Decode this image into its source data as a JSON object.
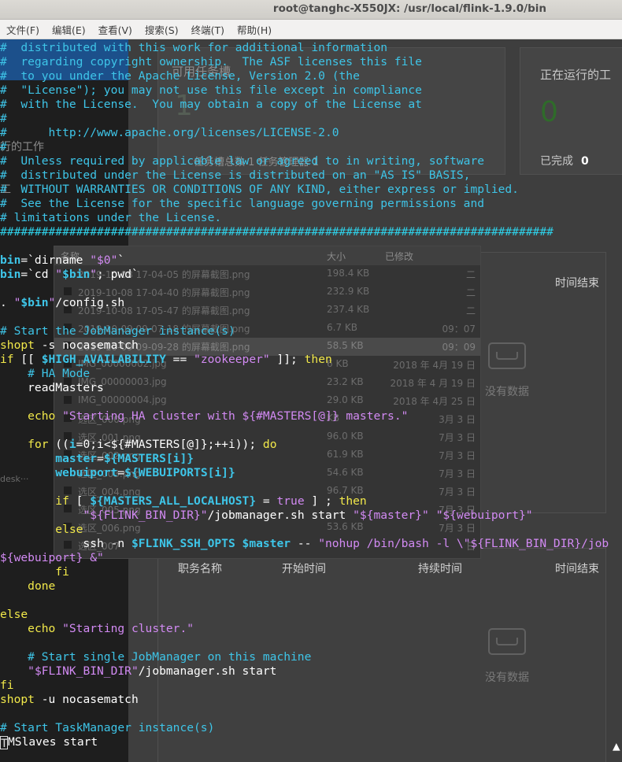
{
  "window": {
    "title": "root@tanghc-X550JX: /usr/local/flink-1.9.0/bin"
  },
  "menu": [
    "文件(F)",
    "编辑(E)",
    "查看(V)",
    "搜索(S)",
    "终端(T)",
    "帮助(H)"
  ],
  "background": {
    "slots_label": "可用任务槽",
    "slots_value": "1",
    "slots_footer": "任务槽总数 1   任务管理器 1",
    "running_jobs_label": "正在运行的工",
    "running_count": "0",
    "completed_label": "已完成",
    "completed_value": "0",
    "running_side_label": "行的工作",
    "work_side_label": "工",
    "end_time_label": "时间结束",
    "no_data": "没有数据",
    "desk_label": "desk···",
    "table_headers": [
      "职务名称",
      "开始时间",
      "持续时间",
      "时间结束"
    ],
    "file_headers": [
      "名称",
      "大小",
      "已修改"
    ],
    "files": [
      {
        "name": "2019-10-08 17-04-05 的屏幕截图.png",
        "size": "198.4 KB",
        "date": "二"
      },
      {
        "name": "2019-10-08 17-04-40 的屏幕截图.png",
        "size": "232.9 KB",
        "date": "二"
      },
      {
        "name": "2019-10-08 17-05-47 的屏幕截图.png",
        "size": "237.4 KB",
        "date": "二"
      },
      {
        "name": "2019-10-09 09-07-18 的屏幕截图.png",
        "size": "6.7 KB",
        "date": "09：07"
      },
      {
        "name": "2019-10-09 09-09-28 的屏幕截图.png",
        "size": "58.5 KB",
        "date": "09：09"
      },
      {
        "name": "IMG_00000002.jpg",
        "size": "6 KB",
        "date": "2018 年 4月 19 日"
      },
      {
        "name": "IMG_00000003.jpg",
        "size": "23.2 KB",
        "date": "2018 年 4 月 19 日"
      },
      {
        "name": "IMG_00000004.jpg",
        "size": "29.0 KB",
        "date": "2018 年 4月 25 日"
      },
      {
        "name": "选区_000.png",
        "size": "KB",
        "date": "3月 3 日"
      },
      {
        "name": "选区_001.png",
        "size": "96.0 KB",
        "date": "7月 3 日"
      },
      {
        "name": "选区_002.png",
        "size": "61.9 KB",
        "date": "7月 3 日"
      },
      {
        "name": "选区_003.png",
        "size": "54.6 KB",
        "date": "7月 3 日"
      },
      {
        "name": "选区_004.png",
        "size": "96.7 KB",
        "date": "7月 3 日"
      },
      {
        "name": "选区_005.png",
        "size": "",
        "date": "7月 3 日"
      },
      {
        "name": "选区_006.png",
        "size": "53.6 KB",
        "date": "7月 3 日"
      },
      {
        "name": "选区_007",
        "size": "",
        "date": "日"
      }
    ]
  },
  "terminal": {
    "lines": [
      [
        [
          "c",
          "#  distributed with this work for additional information"
        ]
      ],
      [
        [
          "c",
          "#  regarding copyright ownership.  The ASF licenses this file"
        ]
      ],
      [
        [
          "c",
          "#  to you under the Apache License, Version 2.0 (the"
        ]
      ],
      [
        [
          "c",
          "#  \"License\"); you may not use this file except in compliance"
        ]
      ],
      [
        [
          "c",
          "#  with the License.  You may obtain a copy of the License at"
        ]
      ],
      [
        [
          "c",
          "#"
        ]
      ],
      [
        [
          "c",
          "#      http://www.apache.org/licenses/LICENSE-2.0"
        ]
      ],
      [
        [
          "c",
          "#"
        ]
      ],
      [
        [
          "c",
          "#  Unless required by applicable law or agreed to in writing, software"
        ]
      ],
      [
        [
          "c",
          "#  distributed under the License is distributed on an \"AS IS\" BASIS,"
        ]
      ],
      [
        [
          "c",
          "#  WITHOUT WARRANTIES OR CONDITIONS OF ANY KIND, either express or implied."
        ]
      ],
      [
        [
          "c",
          "#  See the License for the specific language governing permissions and"
        ]
      ],
      [
        [
          "c",
          "# limitations under the License."
        ]
      ],
      [
        [
          "hash",
          "################################################################################"
        ]
      ],
      [
        [
          "t",
          ""
        ]
      ],
      [
        [
          "v",
          "bin"
        ],
        [
          "t",
          "=`dirname "
        ],
        [
          "s",
          "\"$0\""
        ],
        [
          "t",
          "`"
        ]
      ],
      [
        [
          "v",
          "bin"
        ],
        [
          "t",
          "=`cd "
        ],
        [
          "s",
          "\""
        ],
        [
          "v",
          "$bin"
        ],
        [
          "s",
          "\""
        ],
        [
          "t",
          "; pwd`"
        ]
      ],
      [
        [
          "t",
          ""
        ]
      ],
      [
        [
          "t",
          ". "
        ],
        [
          "s",
          "\""
        ],
        [
          "v",
          "$bin"
        ],
        [
          "s",
          "\""
        ],
        [
          "t",
          "/config.sh"
        ]
      ],
      [
        [
          "t",
          ""
        ]
      ],
      [
        [
          "c",
          "# Start the JobManager instance(s)"
        ]
      ],
      [
        [
          "k",
          "shopt"
        ],
        [
          "t",
          " -s nocasematch"
        ]
      ],
      [
        [
          "k",
          "if"
        ],
        [
          "t",
          " [[ "
        ],
        [
          "v",
          "$HIGH_AVAILABILITY"
        ],
        [
          "t",
          " == "
        ],
        [
          "s",
          "\"zookeeper\""
        ],
        [
          "t",
          " ]]; "
        ],
        [
          "k",
          "then"
        ]
      ],
      [
        [
          "c",
          "    # HA Mode"
        ]
      ],
      [
        [
          "t",
          "    readMasters"
        ]
      ],
      [
        [
          "t",
          ""
        ]
      ],
      [
        [
          "t",
          "    "
        ],
        [
          "k",
          "echo"
        ],
        [
          "s",
          " \"Starting HA cluster with ${#MASTERS[@]} masters.\""
        ]
      ],
      [
        [
          "t",
          ""
        ]
      ],
      [
        [
          "t",
          "    "
        ],
        [
          "k",
          "for"
        ],
        [
          "t",
          " (("
        ],
        [
          "v",
          "i"
        ],
        [
          "t",
          "=0;i<${#MASTERS[@]};++i)); "
        ],
        [
          "k",
          "do"
        ]
      ],
      [
        [
          "t",
          "        "
        ],
        [
          "v",
          "master"
        ],
        [
          "t",
          "="
        ],
        [
          "v",
          "${MASTERS[i]}"
        ]
      ],
      [
        [
          "t",
          "        "
        ],
        [
          "v",
          "webuiport"
        ],
        [
          "t",
          "="
        ],
        [
          "v",
          "${WEBUIPORTS[i]}"
        ]
      ],
      [
        [
          "t",
          ""
        ]
      ],
      [
        [
          "t",
          "        "
        ],
        [
          "k",
          "if"
        ],
        [
          "t",
          " [ "
        ],
        [
          "v",
          "${MASTERS_ALL_LOCALHOST}"
        ],
        [
          "t",
          " = "
        ],
        [
          "s",
          "true"
        ],
        [
          "t",
          " ] ; "
        ],
        [
          "k",
          "then"
        ]
      ],
      [
        [
          "t",
          "            "
        ],
        [
          "s",
          "\"${FLINK_BIN_DIR}\""
        ],
        [
          "t",
          "/jobmanager.sh start "
        ],
        [
          "s",
          "\"${master}\""
        ],
        [
          "t",
          " "
        ],
        [
          "s",
          "\"${webuiport}\""
        ]
      ],
      [
        [
          "t",
          "        "
        ],
        [
          "k",
          "else"
        ]
      ],
      [
        [
          "t",
          "            ssh -n "
        ],
        [
          "v",
          "$FLINK_SSH_OPTS"
        ],
        [
          "t",
          " "
        ],
        [
          "v",
          "$master"
        ],
        [
          "t",
          " -- "
        ],
        [
          "s",
          "\"nohup /bin/bash -l \\\"${FLINK_BIN_DIR}/job"
        ]
      ],
      [
        [
          "s",
          "${webuiport} &\""
        ]
      ],
      [
        [
          "t",
          "        "
        ],
        [
          "k",
          "fi"
        ]
      ],
      [
        [
          "t",
          "    "
        ],
        [
          "k",
          "done"
        ]
      ],
      [
        [
          "t",
          ""
        ]
      ],
      [
        [
          "k",
          "else"
        ]
      ],
      [
        [
          "t",
          "    "
        ],
        [
          "k",
          "echo"
        ],
        [
          "s",
          " \"Starting cluster.\""
        ]
      ],
      [
        [
          "t",
          ""
        ]
      ],
      [
        [
          "c",
          "    # Start single JobManager on this machine"
        ]
      ],
      [
        [
          "t",
          "    "
        ],
        [
          "s",
          "\"$FLINK_BIN_DIR\""
        ],
        [
          "t",
          "/jobmanager.sh start"
        ]
      ],
      [
        [
          "k",
          "fi"
        ]
      ],
      [
        [
          "k",
          "shopt"
        ],
        [
          "t",
          " -u nocasematch"
        ]
      ],
      [
        [
          "t",
          ""
        ]
      ],
      [
        [
          "c",
          "# Start TaskManager instance(s)"
        ]
      ],
      [
        [
          "cursor",
          "T"
        ],
        [
          "t",
          "MSlaves start"
        ]
      ]
    ]
  }
}
